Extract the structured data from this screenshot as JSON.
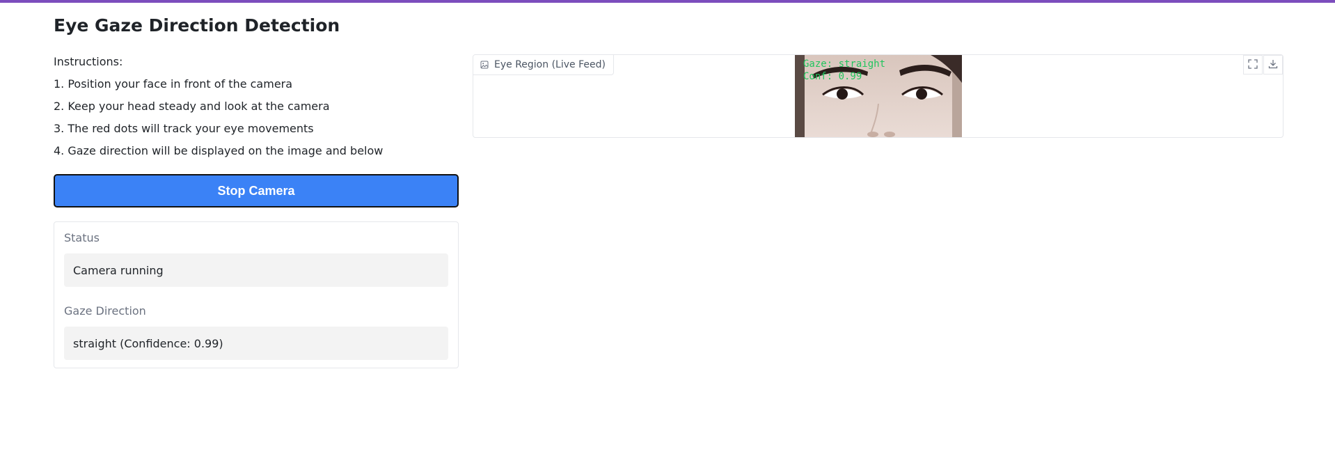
{
  "app": {
    "title": "Eye Gaze Direction Detection",
    "accent_color": "#7c4dbd"
  },
  "instructions": {
    "heading": "Instructions:",
    "steps": [
      "1. Position your face in front of the camera",
      "2. Keep your head steady and look at the camera",
      "3. The red dots will track your eye movements",
      "4. Gaze direction will be displayed on the image and below"
    ]
  },
  "controls": {
    "stop_button_label": "Stop Camera",
    "button_color": "#3b82f6"
  },
  "outputs": {
    "status": {
      "label": "Status",
      "value": "Camera running"
    },
    "gaze": {
      "label": "Gaze Direction",
      "value": "straight (Confidence: 0.99)"
    }
  },
  "image_panel": {
    "label": "Eye Region (Live Feed)",
    "label_icon": "image-icon",
    "actions": [
      "fullscreen-icon",
      "download-icon"
    ],
    "overlay": {
      "gaze_text": "Gaze: straight",
      "conf_text": "Conf: 0.99",
      "text_color": "#22c55e"
    }
  }
}
